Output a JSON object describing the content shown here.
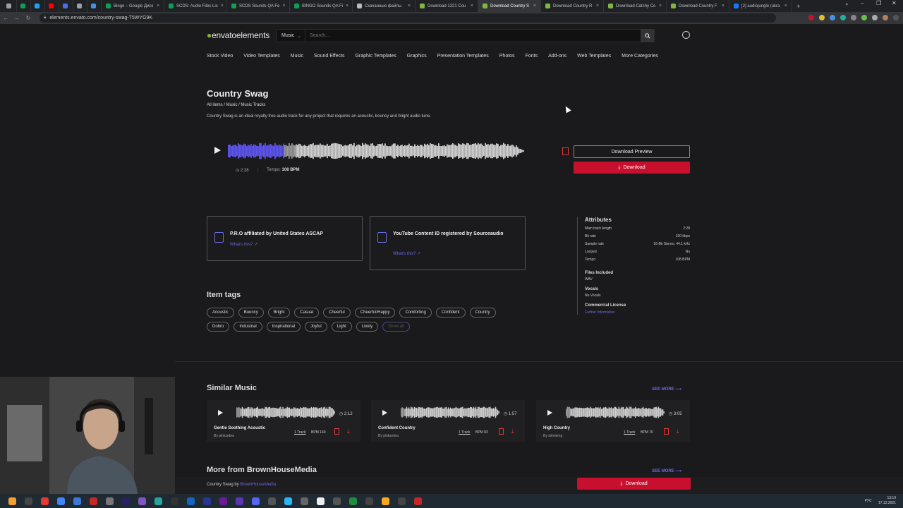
{
  "browser": {
    "tabs": [
      {
        "label": "",
        "color": "#9aa0a6"
      },
      {
        "label": "",
        "color": "#0f9d58"
      },
      {
        "label": "",
        "color": "#1da1f2"
      },
      {
        "label": "",
        "color": "#ff0000"
      },
      {
        "label": "",
        "color": "#4a6ee0"
      },
      {
        "label": "",
        "color": "#9aa0a6"
      },
      {
        "label": "",
        "color": "#4a90e2"
      },
      {
        "label": "Bingo – Google Диск",
        "color": "#0f9d58"
      },
      {
        "label": "SCDS: Audio Files Lis",
        "color": "#0f9d58"
      },
      {
        "label": "SCDS Sounds QA Fe",
        "color": "#0f9d58"
      },
      {
        "label": "BINGO Sounds QA Fi",
        "color": "#0f9d58"
      },
      {
        "label": "Скачанные файлы",
        "color": "#bbb"
      },
      {
        "label": "Download 1221 Cou",
        "color": "#82b541"
      },
      {
        "label": "Download Country S",
        "color": "#82b541",
        "active": true
      },
      {
        "label": "Download Country R",
        "color": "#82b541"
      },
      {
        "label": "Download Catchy Co",
        "color": "#82b541"
      },
      {
        "label": "Download Country F",
        "color": "#82b541"
      },
      {
        "label": "[2] audiojungle (ukra",
        "color": "#1877f2"
      }
    ],
    "url": "elements.envato.com/country-swag-T5WYG9K"
  },
  "site": {
    "logo_a": "envato",
    "logo_b": "elements",
    "search_category": "Music",
    "search_placeholder": "Search...",
    "nav": [
      "Stock Video",
      "Video Templates",
      "Music",
      "Sound Effects",
      "Graphic Templates",
      "Graphics",
      "Presentation Templates",
      "Photos",
      "Fonts",
      "Add-ons",
      "Web Templates",
      "More Categories"
    ]
  },
  "item": {
    "title": "Country Swag",
    "breadcrumb": "All items / Music / Music Tracks",
    "description": "Country Swag is an ideal royalty free audio track for any project that requires an acoustic, bouncy and bright audio tune.",
    "duration": "2:28",
    "tempo_label": "Tempo:",
    "tempo_value": "108 BPM",
    "progress_fraction": 0.19,
    "preview_label": "Download Preview",
    "download_label": "Download"
  },
  "cards": [
    {
      "title": "P.R.O affiliated by United States ASCAP",
      "link": "What's this?"
    },
    {
      "title": "YouTube Content ID registered by Sourceaudio",
      "link": "What's this?"
    }
  ],
  "attributes": {
    "heading": "Attributes",
    "rows": [
      {
        "label": "Main track length",
        "value": "2:28"
      },
      {
        "label": "Bit rate",
        "value": "320 kbps"
      },
      {
        "label": "Sample rate",
        "value": "16-Bit Stereo, 44.1 kHz"
      },
      {
        "label": "Looped",
        "value": "No"
      },
      {
        "label": "Tempo",
        "value": "108 BPM"
      }
    ],
    "files_heading": "Files Included",
    "files_value": "WAV",
    "vocals_heading": "Vocals",
    "vocals_value": "No Vocals",
    "license_heading": "Commercial License",
    "license_link": "Further Information"
  },
  "tags": {
    "heading": "Item tags",
    "items": [
      "Acoustic",
      "Bouncy",
      "Bright",
      "Casual",
      "Cheerful",
      "Cheerful/Happy",
      "Comforting",
      "Confident",
      "Country",
      "Dobro",
      "Industrial",
      "Inspirational",
      "Joyful",
      "Light",
      "Lively",
      "Show all"
    ]
  },
  "similar": {
    "heading": "Similar Music",
    "see_more": "SEE MORE",
    "tracks": [
      {
        "title": "Gentle Soothing Acoustic",
        "author_prefix": "By ",
        "author": "pinkzebra",
        "duration": "2:12",
        "tracks": "1 Track",
        "bpm": "BPM 140"
      },
      {
        "title": "Confident Country",
        "author_prefix": "By ",
        "author": "pinkzebra",
        "duration": "1:57",
        "tracks": "1 Track",
        "bpm": "BPM 83"
      },
      {
        "title": "High Country",
        "author_prefix": "By ",
        "author": "simmimg",
        "duration": "3:05",
        "tracks": "1 Track",
        "bpm": "BPM 70"
      }
    ]
  },
  "more": {
    "heading": "More from BrownHouseMedia",
    "see_more": "SEE MORE"
  },
  "sticky": {
    "item": "Country Swag by ",
    "author": "BrownHouseMedia",
    "download_label": "Download"
  },
  "taskbar": {
    "lang": "РУС",
    "time": "13:19",
    "date": "17.12.2021"
  }
}
